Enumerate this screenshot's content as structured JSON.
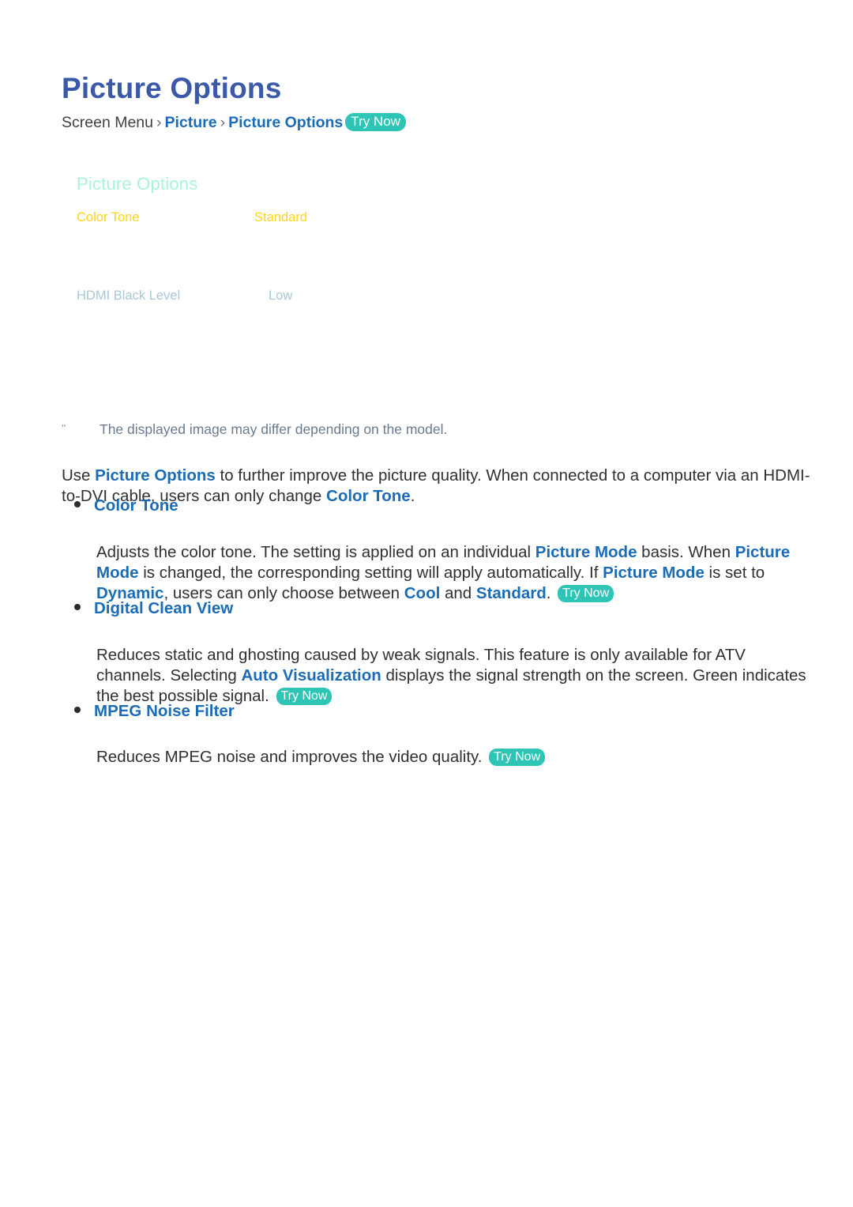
{
  "page": {
    "title": "Picture Options"
  },
  "breadcrumb": {
    "root": "Screen Menu",
    "sep": "›",
    "level1": "Picture",
    "level2": "Picture Options",
    "try_now": "Try Now"
  },
  "tv_menu": {
    "title": "Picture Options",
    "rows": [
      {
        "label": "Color Tone",
        "value": "Standard",
        "state": "selected",
        "label_color": "#ffd41c"
      },
      {
        "label": "HDMI Black Level",
        "value": "Low",
        "state": "normal",
        "label_color": "#a8c8d6"
      }
    ]
  },
  "note": {
    "mark": "\"",
    "text": "The displayed image may differ depending on the model."
  },
  "intro": {
    "pre": "Use ",
    "link1": "Picture Options",
    "mid": " to further improve the picture quality. When connected to a computer via an HDMI-to-DVI cable, users can only change ",
    "link2": "Color Tone",
    "post": "."
  },
  "sections": [
    {
      "heading": "Color Tone",
      "body": {
        "s1": "Adjusts the color tone. The setting is applied on an individual ",
        "l1": "Picture Mode",
        "s2": " basis. When ",
        "l2": "Picture Mode",
        "s3": " is changed, the corresponding setting will apply automatically. If ",
        "l3": "Picture Mode",
        "s4": " is set to ",
        "l4": "Dynamic",
        "s5": ", users can only choose between ",
        "l5": "Cool",
        "s6": " and ",
        "l6": "Standard",
        "s7": ". ",
        "try_now": "Try Now"
      }
    },
    {
      "heading": "Digital Clean View",
      "body": {
        "s1": "Reduces static and ghosting caused by weak signals. This feature is only available for ATV channels. Selecting ",
        "l1": "Auto Visualization",
        "s2": " displays the signal strength on the screen. Green indicates the best possible signal. ",
        "try_now": "Try Now"
      }
    },
    {
      "heading": "MPEG Noise Filter",
      "body": {
        "s1": "Reduces MPEG noise and improves the video quality. ",
        "try_now": "Try Now"
      }
    }
  ],
  "colors": {
    "title_blue": "#3a5aa8",
    "link_blue": "#1b6cb5",
    "badge_teal": "#2ec4b6",
    "menu_title_mint": "#a9f3d9",
    "menu_selected_yellow": "#ffd41c",
    "menu_normal_blue_gray": "#a8c8d6",
    "body_text": "#303030",
    "note_text": "#6b7a90"
  }
}
